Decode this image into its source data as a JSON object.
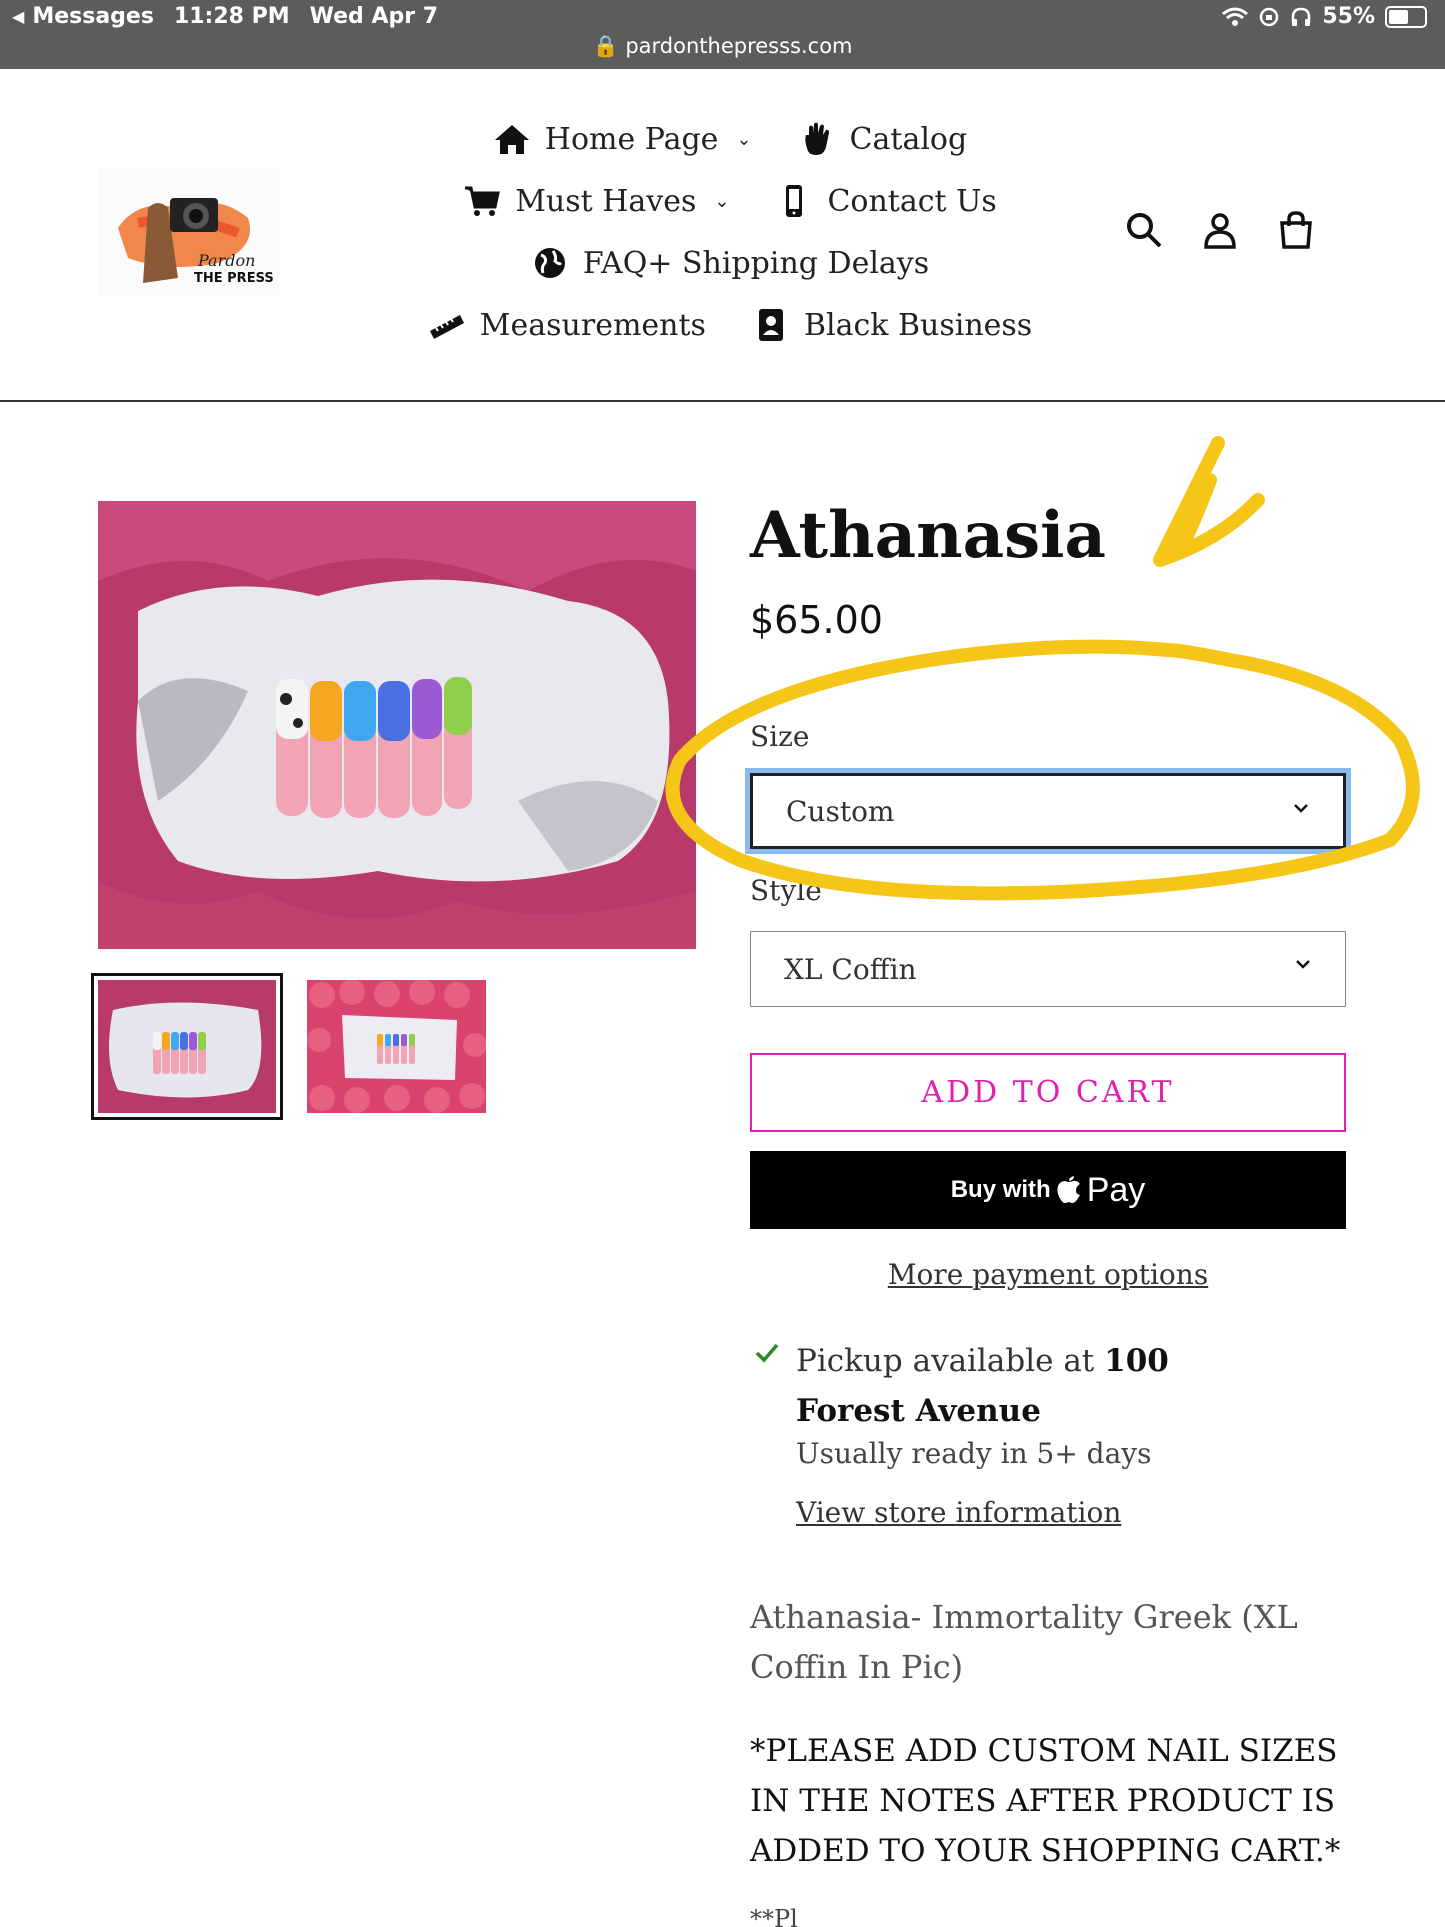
{
  "status_bar": {
    "back_app": "Messages",
    "time": "11:28 PM",
    "date": "Wed Apr 7",
    "battery": "55%",
    "battery_level": 0.55,
    "url": "pardonthepresss.com"
  },
  "nav": {
    "home": "Home Page",
    "catalog": "Catalog",
    "must_haves": "Must Haves",
    "contact": "Contact Us",
    "faq": "FAQ+ Shipping Delays",
    "measurements": "Measurements",
    "black_business": "Black Business"
  },
  "logo": {
    "line1": "Pardon",
    "line2": "THE PRESS"
  },
  "product": {
    "title": "Athanasia",
    "price": "$65.00",
    "size_label": "Size",
    "size_value": "Custom",
    "style_label": "Style",
    "style_value": "XL Coffin",
    "add_to_cart": "ADD TO CART",
    "buy_with": "Buy with",
    "pay": "Pay",
    "more_payment": "More payment options",
    "pickup_prefix": "Pickup available at",
    "pickup_location": "100 Forest Avenue",
    "ready": "Usually ready in 5+ days",
    "store_info": "View store information",
    "description": "Athanasia- Immortality Greek (XL Coffin In Pic)",
    "notice": "*PLEASE ADD CUSTOM NAIL SIZES IN THE NOTES AFTER PRODUCT IS ADDED TO YOUR SHOPPING CART.*",
    "cut_text": "**Pl"
  },
  "colors": {
    "accent": "#e020b0",
    "annotation": "#f5c518",
    "focus": "#8ab8ef",
    "status_bar": "#5c5c5c"
  }
}
